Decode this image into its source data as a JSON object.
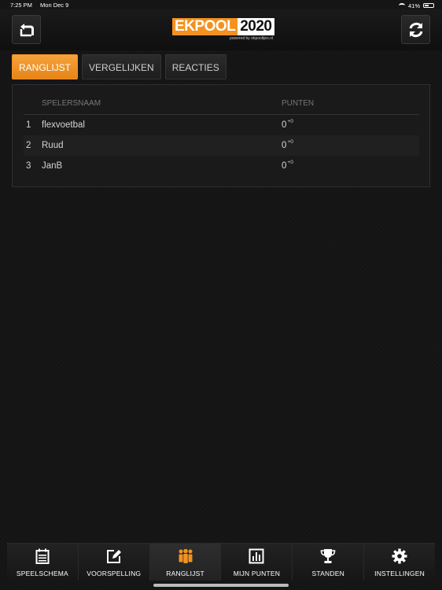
{
  "status": {
    "time": "7:25 PM",
    "date": "Mon Dec 9",
    "battery": "41%"
  },
  "logo": {
    "part1": "EKPOOL",
    "part2": "2020",
    "tagline": "powered by ekpooltjes.nl"
  },
  "tabs": [
    {
      "label": "RANGLIJST",
      "active": true
    },
    {
      "label": "VERGELIJKEN",
      "active": false
    },
    {
      "label": "REACTIES",
      "active": false
    }
  ],
  "table": {
    "col_name": "SPELERSNAAM",
    "col_points": "PUNTEN",
    "rows": [
      {
        "rank": "1",
        "name": "flexvoetbal",
        "points": "0",
        "delta": "+0"
      },
      {
        "rank": "2",
        "name": "Ruud",
        "points": "0",
        "delta": "+0"
      },
      {
        "rank": "3",
        "name": "JanB",
        "points": "0",
        "delta": "+0"
      }
    ]
  },
  "nav": [
    {
      "label": "SPEELSCHEMA",
      "icon": "calendar-icon"
    },
    {
      "label": "VOORSPELLING",
      "icon": "edit-icon"
    },
    {
      "label": "RANGLIJST",
      "icon": "users-icon",
      "active": true
    },
    {
      "label": "MIJN PUNTEN",
      "icon": "bar-chart-icon"
    },
    {
      "label": "STANDEN",
      "icon": "trophy-icon"
    },
    {
      "label": "INSTELLINGEN",
      "icon": "gear-icon"
    }
  ],
  "colors": {
    "accent": "#f39220",
    "background": "#141414"
  }
}
